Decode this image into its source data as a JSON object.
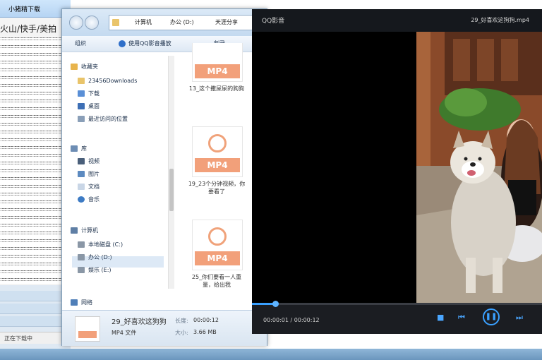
{
  "background_window": {
    "title": "小猪精下载",
    "path_text": "火山/快手/美拍",
    "status_text": "正在下载中"
  },
  "explorer": {
    "address_parts": [
      "计算机",
      "办公 (D:)",
      "天涯分享"
    ],
    "toolbar": {
      "organize": "组织",
      "open_with": "使用QQ影音播放",
      "burn": "刻录"
    },
    "nav": {
      "favorites": "收藏夹",
      "downloads_folder": "23456Downloads",
      "downloads": "下载",
      "desktop": "桌面",
      "recent": "最近访问的位置",
      "library": "库",
      "videos": "视频",
      "pictures": "图片",
      "documents": "文档",
      "music": "音乐",
      "computer": "计算机",
      "drive_c": "本地磁盘 (C:)",
      "drive_d": "办公 (D:)",
      "drive_e": "娱乐 (E:)",
      "network": "网络"
    },
    "files": [
      {
        "badge": "MP4",
        "name": "13_这个撒尿尿的狗狗"
      },
      {
        "badge": "MP4",
        "name": "19_23个分钟视频，你要看了"
      },
      {
        "badge": "MP4",
        "name": "25_你们要看一人重量，给出我"
      }
    ],
    "details": {
      "name": "29_好喜欢这狗狗",
      "type": "MP4 文件",
      "duration_label": "长度:",
      "duration": "00:00:12",
      "size_label": "大小:",
      "size": "3.66 MB"
    }
  },
  "player": {
    "brand": "QQ影音",
    "file_title": "29_好喜欢这狗狗.mp4",
    "time": "00:00:01 / 00:00:12",
    "progress": 0.08,
    "accent_color": "#3aa0ff"
  }
}
